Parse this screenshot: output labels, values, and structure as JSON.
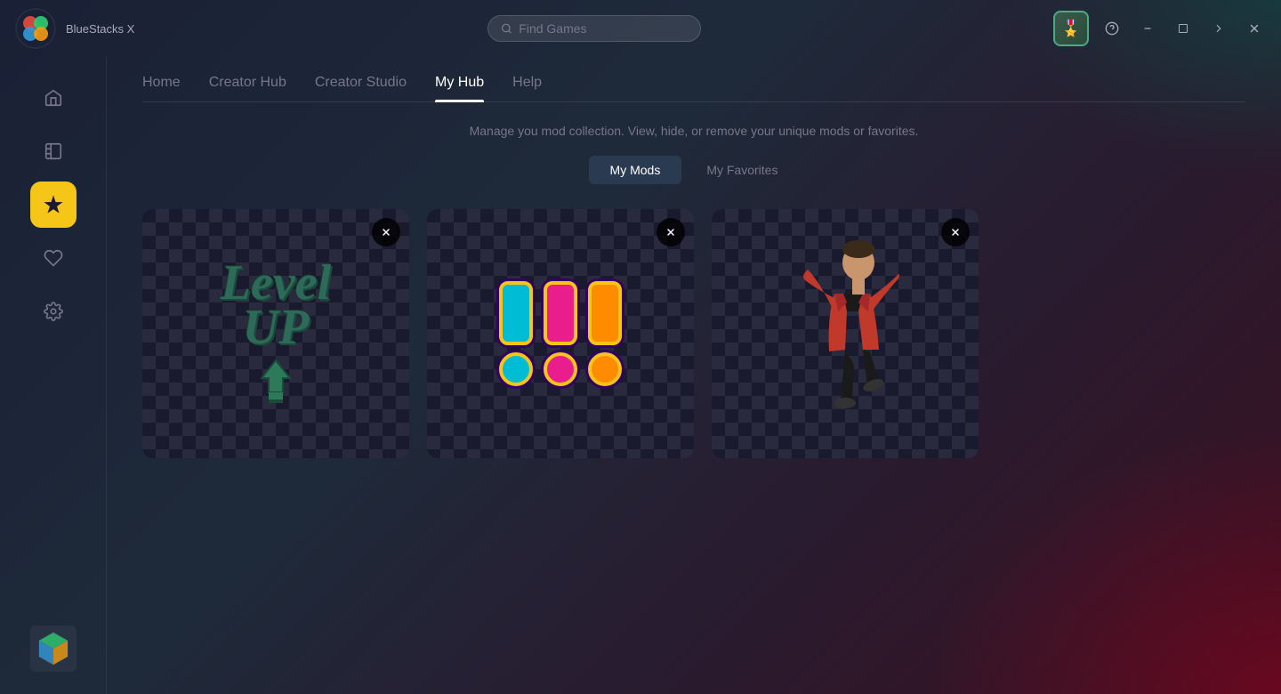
{
  "app": {
    "name": "BlueStacks X",
    "logo_emoji": "🎮"
  },
  "topbar": {
    "search_placeholder": "Find Games",
    "avatar_emoji": "🎖️",
    "buttons": {
      "help": "?",
      "minimize": "—",
      "maximize": "□",
      "forward": "→",
      "close": "✕"
    }
  },
  "sidebar": {
    "items": [
      {
        "id": "home",
        "icon": "⌂",
        "label": "Home",
        "active": false
      },
      {
        "id": "library",
        "icon": "⊡",
        "label": "Library",
        "active": false
      },
      {
        "id": "mods",
        "icon": "★",
        "label": "Mods",
        "active": true
      },
      {
        "id": "favorites",
        "icon": "♡",
        "label": "Favorites",
        "active": false
      },
      {
        "id": "settings",
        "icon": "⚙",
        "label": "Settings",
        "active": false
      }
    ]
  },
  "nav": {
    "tabs": [
      {
        "id": "home",
        "label": "Home",
        "active": false
      },
      {
        "id": "creator-hub",
        "label": "Creator Hub",
        "active": false
      },
      {
        "id": "creator-studio",
        "label": "Creator Studio",
        "active": false
      },
      {
        "id": "my-hub",
        "label": "My Hub",
        "active": true
      },
      {
        "id": "help",
        "label": "Help",
        "active": false
      }
    ]
  },
  "main": {
    "subtitle": "Manage you mod collection. View, hide, or remove your unique mods or favorites.",
    "toggle": {
      "my_mods_label": "My Mods",
      "my_favorites_label": "My Favorites",
      "active": "my-mods"
    },
    "mods": [
      {
        "id": "mod1",
        "type": "level-up",
        "alt": "Level Up mod"
      },
      {
        "id": "mod2",
        "type": "exclamations",
        "alt": "Colorful exclamation marks mod"
      },
      {
        "id": "mod3",
        "type": "dancer",
        "alt": "Dancing person mod"
      }
    ]
  },
  "bottom": {
    "logo_label": "BlueStacks"
  }
}
